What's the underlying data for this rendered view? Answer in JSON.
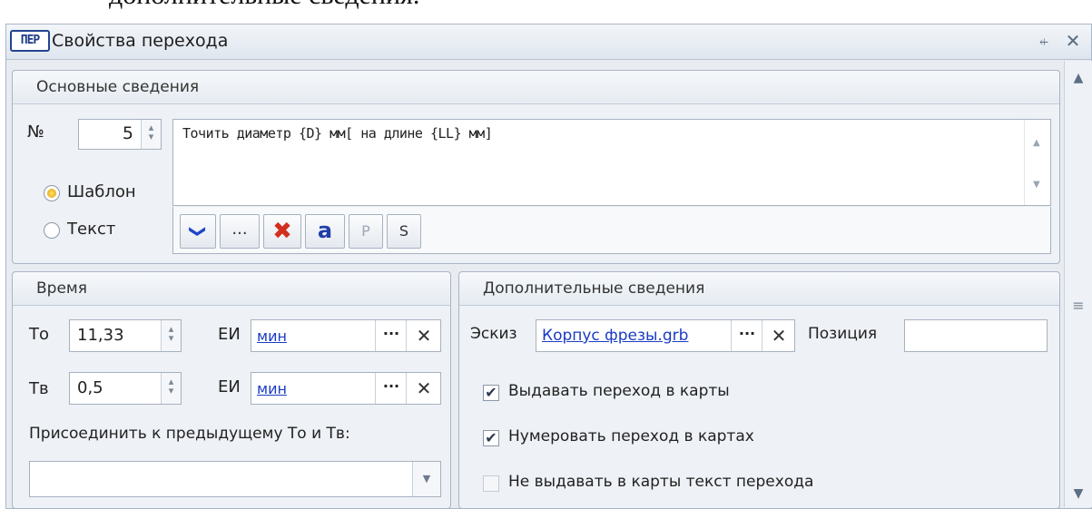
{
  "doc_caption": "дополнительные сведения.",
  "window": {
    "icon_text": "ПЕР",
    "title": "Свойства перехода",
    "pin_glyph": "⍅",
    "close_glyph": "✕"
  },
  "main_group": {
    "title": "Основные сведения",
    "number_label": "№",
    "number_value": "5",
    "template_text": "Точить диаметр {D} мм[ на длине {LL} мм]",
    "radio_template": "Шаблон",
    "radio_text": "Текст",
    "selected_mode": "Шаблон",
    "toolbar": {
      "chevron": "❯",
      "ellipsis": "...",
      "delete": "✖",
      "font": "a",
      "p": "P",
      "s": "S"
    }
  },
  "time_group": {
    "title": "Время",
    "to_label": "То",
    "to_value": "11,33",
    "tv_label": "Тв",
    "tv_value": "0,5",
    "unit_label": "ЕИ",
    "unit_value": "мин",
    "attach_label": "Присоединить к предыдущему То и Тв:",
    "attach_value": ""
  },
  "extra_group": {
    "title": "Дополнительные сведения",
    "sketch_label": "Эскиз",
    "sketch_value": "Корпус фрезы.grb",
    "position_label": "Позиция",
    "position_value": "",
    "checks": [
      {
        "label": "Выдавать переход в карты",
        "checked": true
      },
      {
        "label": "Нумеровать переход в картах",
        "checked": true
      },
      {
        "label": "Не выдавать в карты текст перехода",
        "checked": false
      }
    ]
  },
  "accent_colors": {
    "link": "#1a3cc2",
    "delete_icon": "#d32f1f",
    "radio_selected": "#e39b00"
  }
}
